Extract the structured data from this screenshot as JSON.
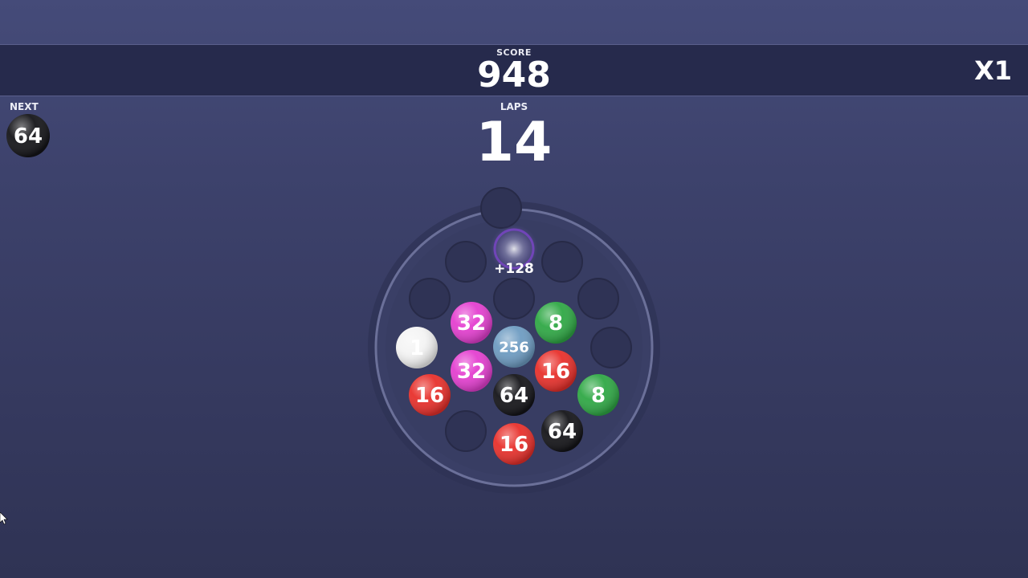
{
  "header": {
    "score_label": "SCORE",
    "score_value": "948",
    "multiplier": "X1"
  },
  "next": {
    "label": "NEXT",
    "value": "64",
    "color": "black"
  },
  "laps": {
    "label": "LAPS",
    "value": "14"
  },
  "score_popup": "+128",
  "balls": [
    {
      "value": "1",
      "color": "white",
      "slot": "ring-9"
    },
    {
      "value": "32",
      "color": "magenta",
      "slot": "inner-top-left"
    },
    {
      "value": "8",
      "color": "green",
      "slot": "inner-top-right"
    },
    {
      "value": "256",
      "color": "lightblue",
      "slot": "center"
    },
    {
      "value": "32",
      "color": "magenta",
      "slot": "inner-bottom-left"
    },
    {
      "value": "16",
      "color": "red",
      "slot": "inner-bottom-right"
    },
    {
      "value": "64",
      "color": "black",
      "slot": "inner-bottom"
    },
    {
      "value": "16",
      "color": "red",
      "slot": "ring-8"
    },
    {
      "value": "8",
      "color": "green",
      "slot": "ring-4"
    },
    {
      "value": "64",
      "color": "black",
      "slot": "ring-5"
    },
    {
      "value": "16",
      "color": "red",
      "slot": "ring-6"
    }
  ],
  "colors": {
    "white": "#f4f4f4",
    "magenta": "#e43fd0",
    "green": "#2fa845",
    "lightblue": "#6e9cc2",
    "red": "#e8302b",
    "black": "#141418",
    "slot": "#2f3355",
    "board": "#3a3f66"
  }
}
